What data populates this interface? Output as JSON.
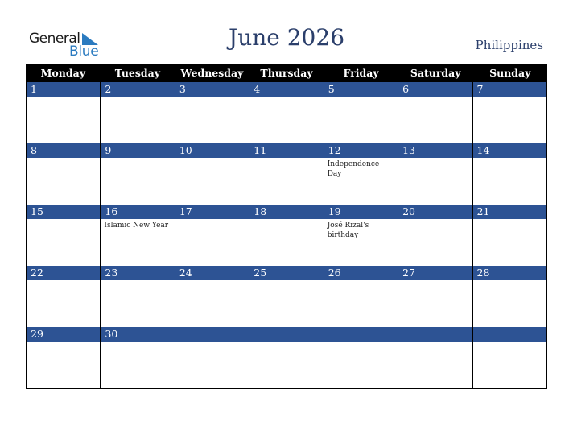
{
  "logo": {
    "line1": "General",
    "line2": "Blue"
  },
  "title": "June 2026",
  "country": "Philippines",
  "colors": {
    "accent": "#2d5394",
    "header_bg": "#000000",
    "title": "#2b3f6b",
    "logo_blue": "#2b7bc0"
  },
  "weekdays": [
    "Monday",
    "Tuesday",
    "Wednesday",
    "Thursday",
    "Friday",
    "Saturday",
    "Sunday"
  ],
  "weeks": [
    [
      {
        "day": "1",
        "event": ""
      },
      {
        "day": "2",
        "event": ""
      },
      {
        "day": "3",
        "event": ""
      },
      {
        "day": "4",
        "event": ""
      },
      {
        "day": "5",
        "event": ""
      },
      {
        "day": "6",
        "event": ""
      },
      {
        "day": "7",
        "event": ""
      }
    ],
    [
      {
        "day": "8",
        "event": ""
      },
      {
        "day": "9",
        "event": ""
      },
      {
        "day": "10",
        "event": ""
      },
      {
        "day": "11",
        "event": ""
      },
      {
        "day": "12",
        "event": "Independence Day"
      },
      {
        "day": "13",
        "event": ""
      },
      {
        "day": "14",
        "event": ""
      }
    ],
    [
      {
        "day": "15",
        "event": ""
      },
      {
        "day": "16",
        "event": "Islamic New Year"
      },
      {
        "day": "17",
        "event": ""
      },
      {
        "day": "18",
        "event": ""
      },
      {
        "day": "19",
        "event": "José Rizal's birthday"
      },
      {
        "day": "20",
        "event": ""
      },
      {
        "day": "21",
        "event": ""
      }
    ],
    [
      {
        "day": "22",
        "event": ""
      },
      {
        "day": "23",
        "event": ""
      },
      {
        "day": "24",
        "event": ""
      },
      {
        "day": "25",
        "event": ""
      },
      {
        "day": "26",
        "event": ""
      },
      {
        "day": "27",
        "event": ""
      },
      {
        "day": "28",
        "event": ""
      }
    ],
    [
      {
        "day": "29",
        "event": ""
      },
      {
        "day": "30",
        "event": ""
      },
      {
        "day": "",
        "event": ""
      },
      {
        "day": "",
        "event": ""
      },
      {
        "day": "",
        "event": ""
      },
      {
        "day": "",
        "event": ""
      },
      {
        "day": "",
        "event": ""
      }
    ]
  ]
}
